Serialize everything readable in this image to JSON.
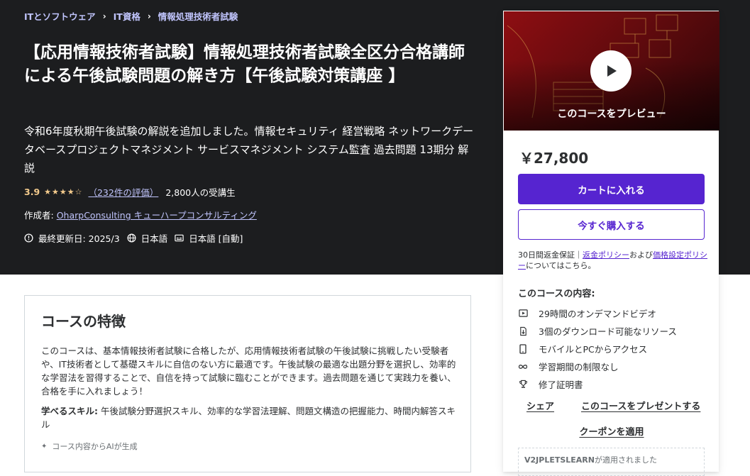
{
  "breadcrumb": [
    "ITとソフトウェア",
    "IT資格",
    "情報処理技術者試験"
  ],
  "breadcrumb_sep": "›",
  "course": {
    "title": "【応用情報技術者試験】情報処理技術者試験全区分合格講師による午後試験問題の解き方【午後試験対策講座 】",
    "subtitle": "令和6年度秋期午後試験の解説を追加しました。情報セキュリティ 経営戦略 ネットワークデータベースプロジェクトマネジメント サービスマネジメント システム監査 過去問題 13期分 解説",
    "rating": "3.9",
    "rating_stars": 3.9,
    "rating_count": "（232件の評価）",
    "students": "2,800人の受講生",
    "author_label": "作成者:",
    "author_name": "OharpConsulting キューハープコンサルティング",
    "last_updated": "最終更新日: 2025/3",
    "language": "日本語",
    "captions": "日本語 [自動]"
  },
  "features": {
    "heading": "コースの特徴",
    "description": "このコースは、基本情報技術者試験に合格したが、応用情報技術者試験の午後試験に挑戦したい受験者や、IT技術者として基礎スキルに自信のない方に最適です。午後試験の最適な出題分野を選択し、効率的な学習法を習得することで、自信を持って試験に臨むことができます。過去問題を通じて実践力を養い、合格を手に入れましょう！",
    "skills_label": "学べるスキル:",
    "skills_text": " 午後試験分野選択スキル、効率的な学習法理解、問題文構造の把握能力、時間内解答スキル",
    "ai_note": "コース内容からAIが生成"
  },
  "sidebar": {
    "preview_label": "このコースをプレビュー",
    "price": "￥27,800",
    "add_to_cart": "カートに入れる",
    "buy_now": "今すぐ購入する",
    "guarantee_text": "30日間返金保証｜",
    "refund_policy": "返金ポリシー",
    "and_text": "および",
    "pricing_policy": "価格設定ポリシー",
    "guarantee_suffix": "についてはこちら。",
    "includes_title": "このコースの内容:",
    "includes": [
      {
        "icon": "video-icon",
        "label": "29時間のオンデマンドビデオ"
      },
      {
        "icon": "download-icon",
        "label": "3個のダウンロード可能なリソース"
      },
      {
        "icon": "mobile-icon",
        "label": "モバイルとPCからアクセス"
      },
      {
        "icon": "infinity-icon",
        "label": "学習期間の制限なし"
      },
      {
        "icon": "trophy-icon",
        "label": "修了証明書"
      }
    ],
    "share": "シェア",
    "gift": "このコースをプレゼントする",
    "apply_coupon": "クーポンを適用",
    "coupon_code": "V2JPLETSLEARN",
    "coupon_text": "が適用されました"
  },
  "colors": {
    "hero_bg": "#1c1d1f",
    "accent": "#5624d0",
    "link_light": "#c0c4fc",
    "star": "#f3ca8c"
  }
}
